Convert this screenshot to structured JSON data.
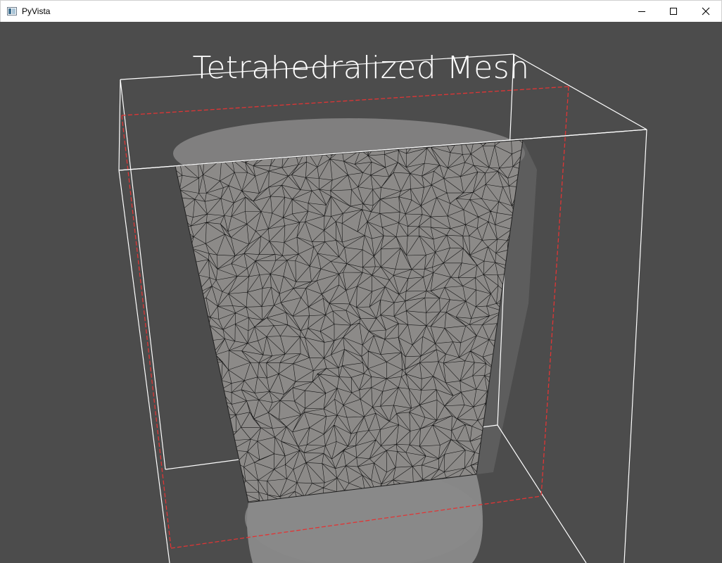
{
  "window": {
    "title": "PyVista",
    "controls": {
      "minimize_icon": "minimize-icon",
      "maximize_icon": "maximize-icon",
      "close_icon": "close-icon"
    }
  },
  "viewport": {
    "background": "#4c4c4c",
    "text_overlay": "Tetrahedralized Mesh",
    "mesh_color": "#8c8a88",
    "edge_color": "#151515",
    "bounding_box_color": "#ffffff",
    "inner_box_color": "#ff3030"
  }
}
